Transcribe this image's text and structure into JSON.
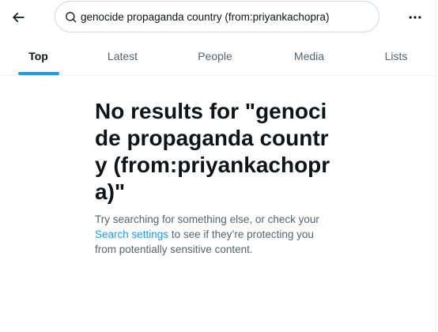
{
  "search": {
    "value": "genocide propaganda country (from:priyankachopra)",
    "placeholder": "Search"
  },
  "icons": {
    "back": "arrow-left-icon",
    "search": "search-icon",
    "more": "more-horizontal-icon"
  },
  "tabs": [
    {
      "label": "Top",
      "active": true
    },
    {
      "label": "Latest",
      "active": false
    },
    {
      "label": "People",
      "active": false
    },
    {
      "label": "Media",
      "active": false
    },
    {
      "label": "Lists",
      "active": false
    }
  ],
  "empty_state": {
    "title": "No results for \"genocide propaganda country (from:priyankachopra)\"",
    "desc_before": "Try searching for something else, or check your",
    "link": "Search settings",
    "desc_after": "to see if they’re protecting you from potentially sensitive content."
  },
  "colors": {
    "accent": "#1d9bf0",
    "text_primary": "#0f1419",
    "text_secondary": "#536471",
    "border": "#cfd9de"
  }
}
